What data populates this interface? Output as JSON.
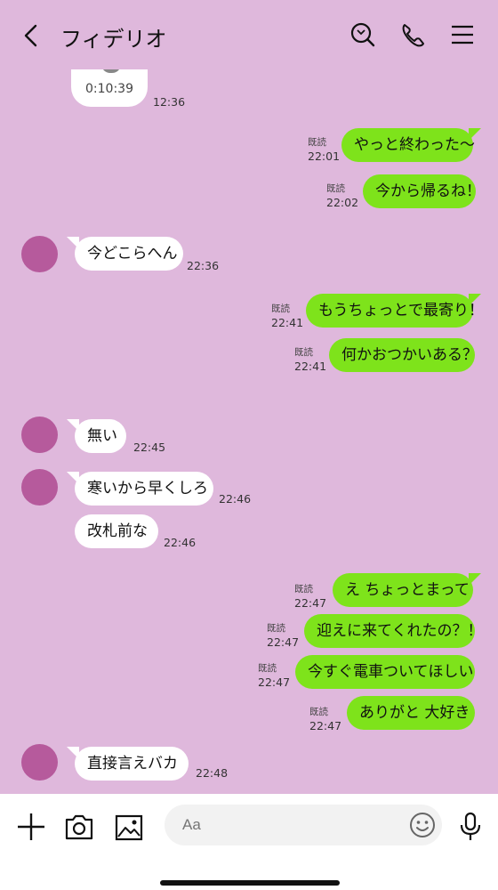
{
  "header": {
    "title": "フィデリオ"
  },
  "audio_message": {
    "duration": "0:10:39",
    "time": "12:36"
  },
  "messages": [
    {
      "dir": "out",
      "text": "やっと終わった～",
      "read": "既読",
      "time": "22:01"
    },
    {
      "dir": "out",
      "text": "今から帰るね！",
      "read": "既読",
      "time": "22:02"
    },
    {
      "dir": "in",
      "text": "今どこらへん",
      "time": "22:36"
    },
    {
      "dir": "out",
      "text": "もうちょっとで最寄り！",
      "read": "既読",
      "time": "22:41"
    },
    {
      "dir": "out",
      "text": "何かおつかいある？",
      "read": "既読",
      "time": "22:41"
    },
    {
      "dir": "in",
      "text": "無い",
      "time": "22:45"
    },
    {
      "dir": "in",
      "text": "寒いから早くしろ",
      "time": "22:46"
    },
    {
      "dir": "in",
      "text": "改札前な",
      "time": "22:46"
    },
    {
      "dir": "out",
      "text": "え ちょっとまって",
      "read": "既読",
      "time": "22:47"
    },
    {
      "dir": "out",
      "text": "迎えに来てくれたの？！",
      "read": "既読",
      "time": "22:47"
    },
    {
      "dir": "out",
      "text": "今すぐ電車ついてほしい",
      "read": "既読",
      "time": "22:47"
    },
    {
      "dir": "out",
      "text": "ありがと 大好き",
      "read": "既読",
      "time": "22:47"
    },
    {
      "dir": "in",
      "text": "直接言えバカ",
      "time": "22:48"
    }
  ],
  "input": {
    "placeholder": "Aa"
  },
  "colors": {
    "background": "#dfb8dc",
    "outgoing_bubble": "#7ee31b",
    "incoming_bubble": "#ffffff",
    "avatar": "#b65a9c"
  },
  "icons": {
    "back": "chevron-left-icon",
    "search": "search-icon",
    "call": "phone-icon",
    "menu": "hamburger-menu-icon",
    "plus": "plus-icon",
    "camera": "camera-icon",
    "image": "image-icon",
    "emoji": "smiley-icon",
    "mic": "microphone-icon"
  }
}
